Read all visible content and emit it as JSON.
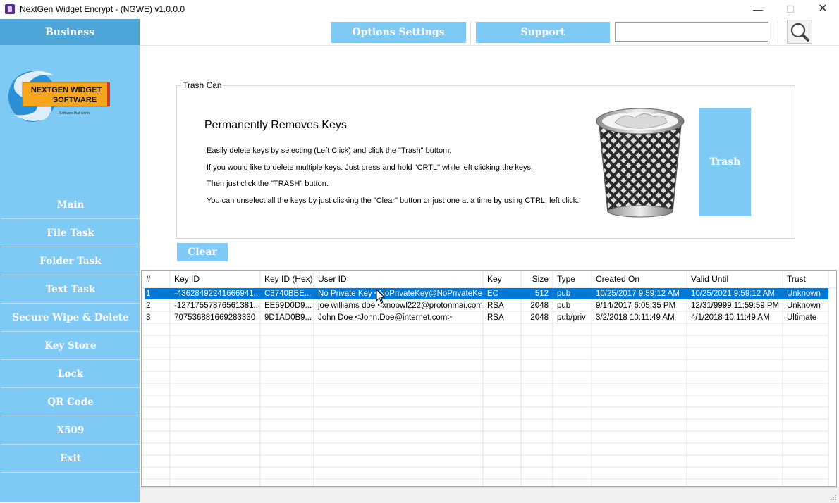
{
  "window": {
    "title": "NextGen Widget Encrypt - (NGWE) v1.0.0.0",
    "minimize": "—",
    "maximize": "☐",
    "close": "✕"
  },
  "sidebar": {
    "header": "Business",
    "logo": {
      "line1": "NEXTGEN WIDGET",
      "line2": "SOFTWARE",
      "tagline": "Software that works"
    },
    "items": [
      {
        "label": "Main"
      },
      {
        "label": "File Task"
      },
      {
        "label": "Folder Task"
      },
      {
        "label": "Text Task"
      },
      {
        "label": "Secure Wipe & Delete"
      },
      {
        "label": "Key Store"
      },
      {
        "label": "Lock"
      },
      {
        "label": "QR Code"
      },
      {
        "label": "X509"
      },
      {
        "label": "Exit"
      }
    ]
  },
  "toolbar": {
    "options_label": "Options Settings",
    "support_label": "Support",
    "search_value": ""
  },
  "trash": {
    "group_title": "Trash Can",
    "heading": "Permanently Removes Keys",
    "lines": [
      "Easily delete keys by selecting (Left Click) and click the \"Trash\" buttom.",
      "If you would like to delete multiple keys. Just press and hold \"CRTL\" while left clicking the keys.",
      "Then just click the \"TRASH\" button.",
      "You can unselect all the keys by just clicking the \"Clear\" button or just one at a time by using CTRL, left click."
    ],
    "trash_label": "Trash",
    "clear_label": "Clear"
  },
  "grid": {
    "columns": [
      "#",
      "Key ID",
      "Key ID (Hex)",
      "User ID",
      "Key",
      "Size",
      "Type",
      "Created On",
      "Valid Until",
      "Trust"
    ],
    "rows": [
      [
        "1",
        "-43628492241666941...",
        "C3740BBE...",
        "No Private Key <NoPrivateKey@NoPrivateKe...",
        "EC",
        "512",
        "pub",
        "10/25/2017 9:59:12 AM",
        "10/25/2021 9:59:12 AM",
        "Unknown"
      ],
      [
        "2",
        "-12717557876561381...",
        "EE59D0D9...",
        "joe williams doe <xnoowl222@protonmai.com>",
        "RSA",
        "2048",
        "pub",
        "9/14/2017 6:05:35 PM",
        "12/31/9999 11:59:59 PM",
        "Unknown"
      ],
      [
        "3",
        "707536881669283330",
        "9D1AD0B9...",
        "John Doe <John.Doe@internet.com>",
        "RSA",
        "2048",
        "pub/priv",
        "3/2/2018 10:11:49 AM",
        "4/1/2018 10:11:49 AM",
        "Ultimate"
      ]
    ],
    "selected_row": 0
  },
  "colors": {
    "sidebar": "#7ecaf5",
    "sidebar_header": "#4ea6d8",
    "selection": "#0078d7"
  },
  "icons": {
    "search": "magnifier-icon",
    "trash": "trash-can-icon"
  }
}
